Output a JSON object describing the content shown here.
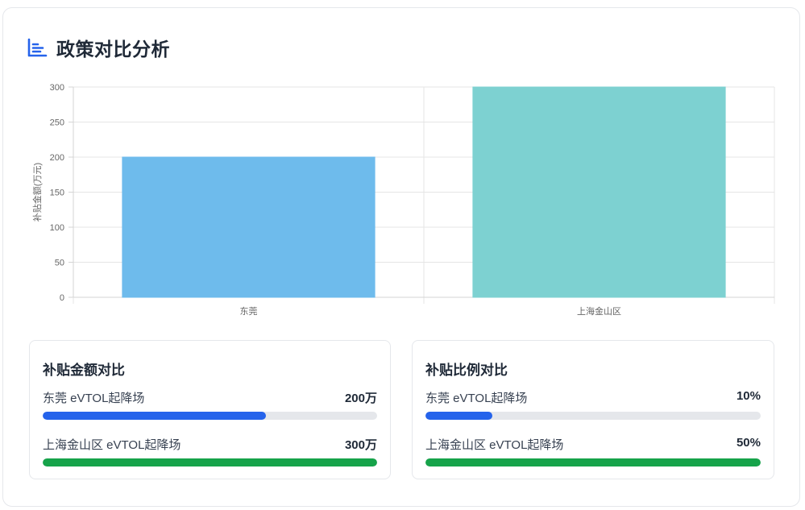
{
  "header": {
    "title": "政策对比分析",
    "icon": "bar-chart-icon",
    "icon_color": "#2563eb"
  },
  "chart_data": {
    "type": "bar",
    "categories": [
      "东莞",
      "上海金山区"
    ],
    "values": [
      200,
      300
    ],
    "colors": [
      "#6ebbec",
      "#7dd1d1"
    ],
    "ylabel": "补贴金额(万元)",
    "ylim": [
      0,
      300
    ],
    "yticks": [
      0,
      50,
      100,
      150,
      200,
      250,
      300
    ],
    "grid": true
  },
  "panels": [
    {
      "title": "补贴金额对比",
      "items": [
        {
          "label": "东莞 eVTOL起降场",
          "value_text": "200万",
          "fraction": 0.667,
          "color": "#2563eb"
        },
        {
          "label": "上海金山区 eVTOL起降场",
          "value_text": "300万",
          "fraction": 1.0,
          "color": "#16a34a"
        }
      ]
    },
    {
      "title": "补贴比例对比",
      "items": [
        {
          "label": "东莞 eVTOL起降场",
          "value_text": "10%",
          "fraction": 0.2,
          "color": "#2563eb"
        },
        {
          "label": "上海金山区 eVTOL起降场",
          "value_text": "50%",
          "fraction": 1.0,
          "color": "#16a34a"
        }
      ]
    }
  ]
}
